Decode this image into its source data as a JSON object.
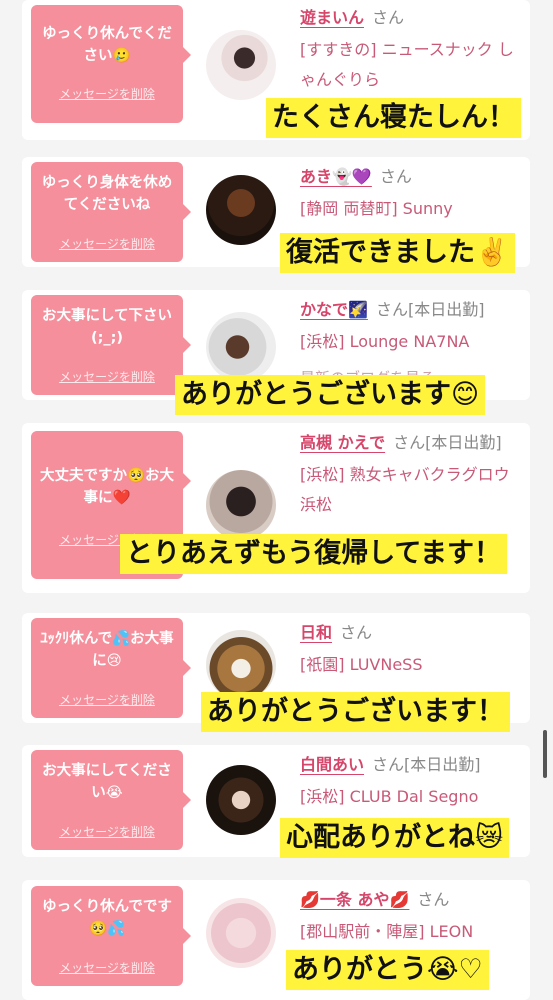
{
  "entries": [
    {
      "message": "ゆっくり休んでください🥲",
      "delete": "メッセージを削除",
      "name": "遊まいん",
      "san": "さん",
      "status": "",
      "shop": "[すすきの] ニュースナック しゃんぐりら",
      "blog": "",
      "caption": "たくさん寝たしん！"
    },
    {
      "message": "ゆっくり身体を休めてくださいね",
      "delete": "メッセージを削除",
      "name": "あき👻💜",
      "san": "さん",
      "status": "",
      "shop": "[静岡 両替町] Sunny",
      "blog": "",
      "caption": "復活できました✌️"
    },
    {
      "message": "お大事にして下さい(;_;)",
      "delete": "メッセージを削除",
      "name": "かなで🌠",
      "san": "さん",
      "status": "[本日出勤]",
      "shop": "[浜松] Lounge NA7NA",
      "blog": "最新のブログを見る",
      "caption": "ありがとうございます😊"
    },
    {
      "message": "大丈夫ですか🥺お大事に❤️",
      "delete": "メッセージを削除",
      "name": "高槻 かえで",
      "san": "さん",
      "status": "[本日出勤]",
      "shop": "[浜松] 熟女キャバクラグロウ 浜松",
      "blog": "",
      "caption": "とりあえずもう復帰してます！"
    },
    {
      "message": "ﾕｯｸﾘ休んで💦お大事に😢",
      "delete": "メッセージを削除",
      "name": "日和",
      "san": "さん",
      "status": "",
      "shop": "[祇園] LUVNeSS",
      "blog": "",
      "caption": "ありがとうございます！"
    },
    {
      "message": "お大事にしてください😭",
      "delete": "メッセージを削除",
      "name": "白間あい",
      "san": "さん",
      "status": "[本日出勤]",
      "shop": "[浜松] CLUB Dal Segno",
      "blog": "",
      "caption": "心配ありがとね😿"
    },
    {
      "message": "ゆっくり休んでです🥺💦",
      "delete": "メッセージを削除",
      "name": "💋一条 あや💋",
      "san": "さん",
      "status": "",
      "shop": "[郡山駅前・陣屋] LEON",
      "blog": "",
      "caption": "ありがとう😭♡"
    }
  ],
  "colors": {
    "bubble": "#f58f9b",
    "name": "#d5466a",
    "caption_bg": "#fff33c"
  }
}
